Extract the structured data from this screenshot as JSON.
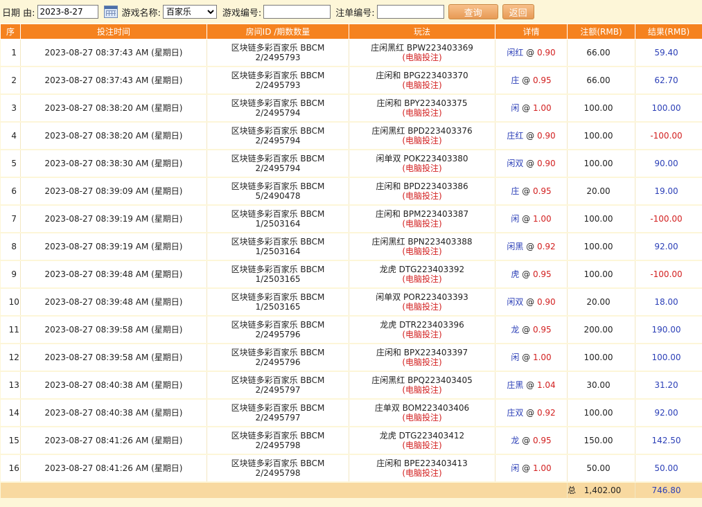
{
  "filter": {
    "date_label": "日期 由:",
    "date_value": "2023-8-27",
    "game_name_label": "游戏名称:",
    "game_name_value": "百家乐",
    "game_no_label": "游戏编号:",
    "bet_no_label": "注单编号:",
    "search_label": "查询",
    "back_label": "返回"
  },
  "table": {
    "headers": {
      "seq": "序",
      "time": "投注时间",
      "room": "房间ID /期数数量",
      "play": "玩法",
      "detail": "详情",
      "bet": "注额(RMB)",
      "result": "结果(RMB)"
    },
    "rows": [
      {
        "seq": "1",
        "time": "2023-08-27 08:37:43 AM (星期日)",
        "room": "区块链多彩百家乐 BBCM",
        "period": "2/2495793",
        "play": "庄闲黑红 BPW223403369",
        "electronic": "(电脑投注)",
        "detail_name": "闲红",
        "odds": "0.90",
        "bet": "66.00",
        "result": "59.40"
      },
      {
        "seq": "2",
        "time": "2023-08-27 08:37:43 AM (星期日)",
        "room": "区块链多彩百家乐 BBCM",
        "period": "2/2495793",
        "play": "庄闲和 BPG223403370",
        "electronic": "(电脑投注)",
        "detail_name": "庄",
        "odds": "0.95",
        "bet": "66.00",
        "result": "62.70"
      },
      {
        "seq": "3",
        "time": "2023-08-27 08:38:20 AM (星期日)",
        "room": "区块链多彩百家乐 BBCM",
        "period": "2/2495794",
        "play": "庄闲和 BPY223403375",
        "electronic": "(电脑投注)",
        "detail_name": "闲",
        "odds": "1.00",
        "bet": "100.00",
        "result": "100.00"
      },
      {
        "seq": "4",
        "time": "2023-08-27 08:38:20 AM (星期日)",
        "room": "区块链多彩百家乐 BBCM",
        "period": "2/2495794",
        "play": "庄闲黑红 BPD223403376",
        "electronic": "(电脑投注)",
        "detail_name": "庄红",
        "odds": "0.90",
        "bet": "100.00",
        "result": "-100.00"
      },
      {
        "seq": "5",
        "time": "2023-08-27 08:38:30 AM (星期日)",
        "room": "区块链多彩百家乐 BBCM",
        "period": "2/2495794",
        "play": "闲单双 POK223403380",
        "electronic": "(电脑投注)",
        "detail_name": "闲双",
        "odds": "0.90",
        "bet": "100.00",
        "result": "90.00"
      },
      {
        "seq": "6",
        "time": "2023-08-27 08:39:09 AM (星期日)",
        "room": "区块链多彩百家乐 BBCM",
        "period": "5/2490478",
        "play": "庄闲和 BPD223403386",
        "electronic": "(电脑投注)",
        "detail_name": "庄",
        "odds": "0.95",
        "bet": "20.00",
        "result": "19.00"
      },
      {
        "seq": "7",
        "time": "2023-08-27 08:39:19 AM (星期日)",
        "room": "区块链多彩百家乐 BBCM",
        "period": "1/2503164",
        "play": "庄闲和 BPM223403387",
        "electronic": "(电脑投注)",
        "detail_name": "闲",
        "odds": "1.00",
        "bet": "100.00",
        "result": "-100.00"
      },
      {
        "seq": "8",
        "time": "2023-08-27 08:39:19 AM (星期日)",
        "room": "区块链多彩百家乐 BBCM",
        "period": "1/2503164",
        "play": "庄闲黑红 BPN223403388",
        "electronic": "(电脑投注)",
        "detail_name": "闲黑",
        "odds": "0.92",
        "bet": "100.00",
        "result": "92.00"
      },
      {
        "seq": "9",
        "time": "2023-08-27 08:39:48 AM (星期日)",
        "room": "区块链多彩百家乐 BBCM",
        "period": "1/2503165",
        "play": "龙虎 DTG223403392",
        "electronic": "(电脑投注)",
        "detail_name": "虎",
        "odds": "0.95",
        "bet": "100.00",
        "result": "-100.00"
      },
      {
        "seq": "10",
        "time": "2023-08-27 08:39:48 AM (星期日)",
        "room": "区块链多彩百家乐 BBCM",
        "period": "1/2503165",
        "play": "闲单双 POR223403393",
        "electronic": "(电脑投注)",
        "detail_name": "闲双",
        "odds": "0.90",
        "bet": "20.00",
        "result": "18.00"
      },
      {
        "seq": "11",
        "time": "2023-08-27 08:39:58 AM (星期日)",
        "room": "区块链多彩百家乐 BBCM",
        "period": "2/2495796",
        "play": "龙虎 DTR223403396",
        "electronic": "(电脑投注)",
        "detail_name": "龙",
        "odds": "0.95",
        "bet": "200.00",
        "result": "190.00"
      },
      {
        "seq": "12",
        "time": "2023-08-27 08:39:58 AM (星期日)",
        "room": "区块链多彩百家乐 BBCM",
        "period": "2/2495796",
        "play": "庄闲和 BPX223403397",
        "electronic": "(电脑投注)",
        "detail_name": "闲",
        "odds": "1.00",
        "bet": "100.00",
        "result": "100.00"
      },
      {
        "seq": "13",
        "time": "2023-08-27 08:40:38 AM (星期日)",
        "room": "区块链多彩百家乐 BBCM",
        "period": "2/2495797",
        "play": "庄闲黑红 BPQ223403405",
        "electronic": "(电脑投注)",
        "detail_name": "庄黑",
        "odds": "1.04",
        "bet": "30.00",
        "result": "31.20"
      },
      {
        "seq": "14",
        "time": "2023-08-27 08:40:38 AM (星期日)",
        "room": "区块链多彩百家乐 BBCM",
        "period": "2/2495797",
        "play": "庄单双 BOM223403406",
        "electronic": "(电脑投注)",
        "detail_name": "庄双",
        "odds": "0.92",
        "bet": "100.00",
        "result": "92.00"
      },
      {
        "seq": "15",
        "time": "2023-08-27 08:41:26 AM (星期日)",
        "room": "区块链多彩百家乐 BBCM",
        "period": "2/2495798",
        "play": "龙虎 DTG223403412",
        "electronic": "(电脑投注)",
        "detail_name": "龙",
        "odds": "0.95",
        "bet": "150.00",
        "result": "142.50"
      },
      {
        "seq": "16",
        "time": "2023-08-27 08:41:26 AM (星期日)",
        "room": "区块链多彩百家乐 BBCM",
        "period": "2/2495798",
        "play": "庄闲和 BPE223403413",
        "electronic": "(电脑投注)",
        "detail_name": "闲",
        "odds": "1.00",
        "bet": "50.00",
        "result": "50.00"
      }
    ],
    "total": {
      "label": "总",
      "bet": "1,402.00",
      "result": "746.80"
    }
  },
  "colors": {
    "header_bg": "#f5821f",
    "page_bg": "#fdf6d8",
    "positive": "#2b3fb7",
    "negative": "#d21f1f",
    "total_bg": "#f8d9a0"
  }
}
